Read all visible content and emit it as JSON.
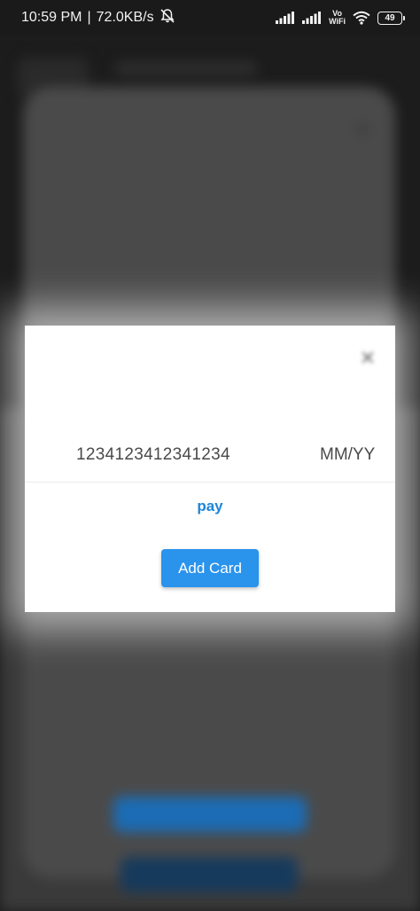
{
  "status_bar": {
    "time": "10:59 PM",
    "separator": "|",
    "network_speed": "72.0KB/s",
    "vowifi_top": "Vo",
    "vowifi_bottom": "WiFi",
    "battery_level": "49"
  },
  "background": {
    "close_icon": "close-icon",
    "subtitle": "",
    "amount": "",
    "primary_button_label": ""
  },
  "dialog": {
    "close_icon": "close-icon",
    "title": "",
    "card_number_value": "1234123412341234",
    "expiry_value": "MM/YY",
    "pay_label": "pay",
    "add_card_label": "Add Card"
  },
  "colors": {
    "accent": "#2a93ec",
    "link": "#1d86d8",
    "dialog_bg": "#ffffff",
    "scrim": "#1c1c1c"
  }
}
